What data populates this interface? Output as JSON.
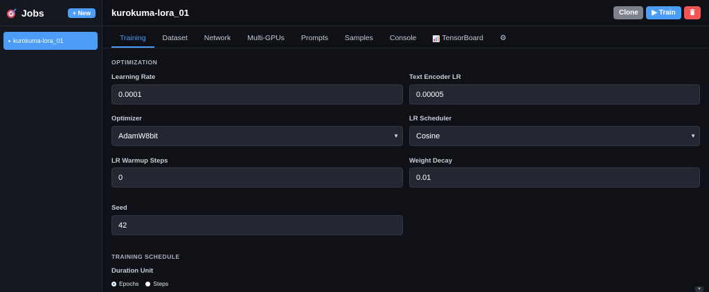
{
  "sidebar": {
    "title": "Jobs",
    "new_label": "+ New",
    "jobs": [
      {
        "label": "kurokuma-lora_01"
      }
    ]
  },
  "header": {
    "title": "kurokuma-lora_01",
    "clone_label": "Clone",
    "train_label": "▶ Train",
    "delete_icon": "trash-icon"
  },
  "tabs": [
    {
      "label": "Training"
    },
    {
      "label": "Dataset"
    },
    {
      "label": "Network"
    },
    {
      "label": "Multi-GPUs"
    },
    {
      "label": "Prompts"
    },
    {
      "label": "Samples"
    },
    {
      "label": "Console"
    },
    {
      "label": "TensorBoard"
    },
    {
      "label": "⚙"
    }
  ],
  "optimization": {
    "section_title": "OPTIMIZATION",
    "learning_rate": {
      "label": "Learning Rate",
      "value": "0.0001"
    },
    "text_encoder_lr": {
      "label": "Text Encoder LR",
      "value": "0.00005"
    },
    "optimizer": {
      "label": "Optimizer",
      "value": "AdamW8bit"
    },
    "lr_scheduler": {
      "label": "LR Scheduler",
      "value": "Cosine"
    },
    "lr_warmup_steps": {
      "label": "LR Warmup Steps",
      "value": "0"
    },
    "weight_decay": {
      "label": "Weight Decay",
      "value": "0.01"
    },
    "seed": {
      "label": "Seed",
      "value": "42"
    }
  },
  "schedule": {
    "section_title": "TRAINING SCHEDULE",
    "duration_unit": {
      "label": "Duration Unit",
      "options": [
        "Epochs",
        "Steps"
      ],
      "selected": "Epochs"
    }
  },
  "colors": {
    "accent": "#4c9df5",
    "danger": "#f25555",
    "neutral": "#7c838d"
  }
}
